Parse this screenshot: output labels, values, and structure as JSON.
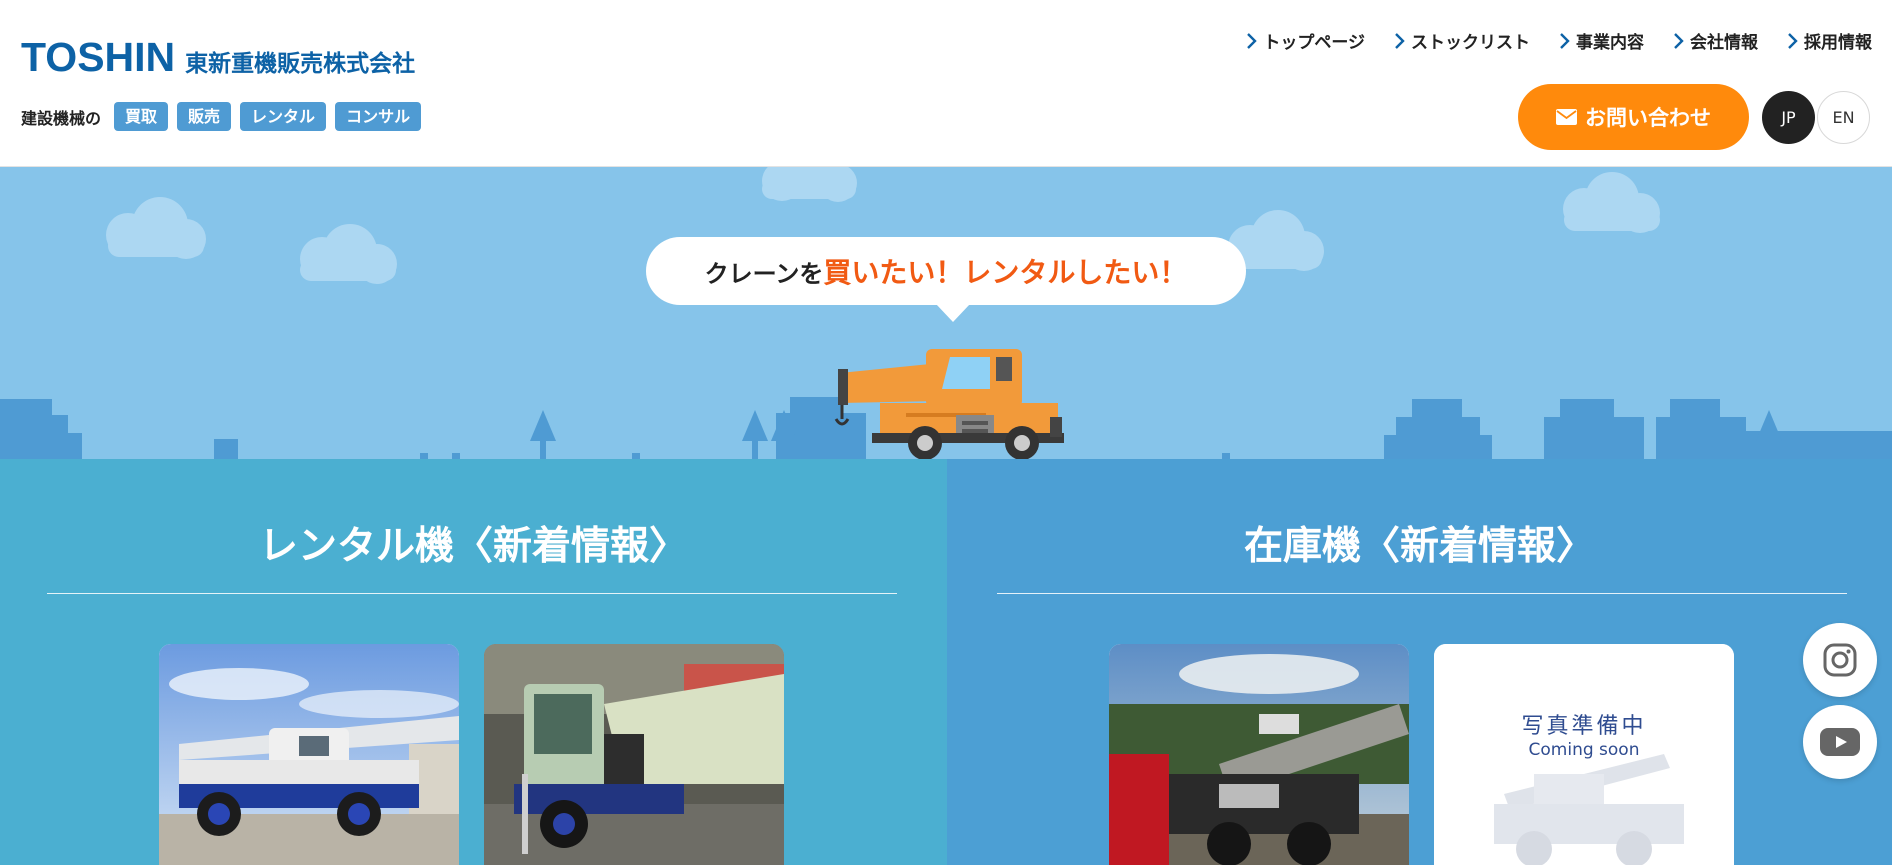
{
  "header": {
    "logo_en": "TOSHIN",
    "logo_ja": "東新重機販売株式会社",
    "services_label": "建設機械の",
    "services": [
      "買取",
      "販売",
      "レンタル",
      "コンサル"
    ]
  },
  "nav": {
    "items": [
      {
        "label": "トップページ",
        "icon": "chevron-right-icon"
      },
      {
        "label": "ストックリスト",
        "icon": "chevron-right-icon"
      },
      {
        "label": "事業内容",
        "icon": "chevron-right-icon"
      },
      {
        "label": "会社情報",
        "icon": "chevron-right-icon"
      },
      {
        "label": "採用情報",
        "icon": "chevron-right-icon"
      }
    ],
    "contact_label": "お問い合わせ",
    "contact_icon": "mail-icon",
    "lang_jp": "JP",
    "lang_en": "EN"
  },
  "hero": {
    "bubble_text_plain": "クレーンを",
    "bubble_text_accent": "買いたい！レンタルしたい！"
  },
  "sections": {
    "rental_title": "レンタル機〈新着情報〉",
    "stock_title": "在庫機〈新着情報〉",
    "placeholder_line1": "写真準備中",
    "placeholder_line2": "Coming soon"
  },
  "social": {
    "instagram_icon": "instagram-icon",
    "youtube_icon": "youtube-icon"
  },
  "colors": {
    "brand_blue": "#0d62a6",
    "accent_orange": "#ff8a0c",
    "bubble_red": "#f15a13",
    "hero_sky": "#86c4ea",
    "rental_bg": "#4bafd1",
    "stock_bg": "#4c9fd4"
  }
}
